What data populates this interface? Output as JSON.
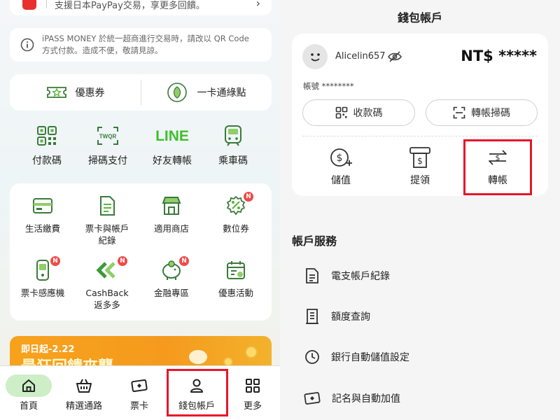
{
  "left": {
    "top_card_text": "支援日本PayPay交易，享更多回饋。",
    "notice_text": "iPASS MONEY 於統一超商進行交易時，請改以 QR Code 方式付款。造成不便，敬請見諒。",
    "coupon_label": "優惠券",
    "points_label": "一卡通綠點",
    "quick_actions": [
      {
        "label": "付款碼",
        "icon": "payment-qr-icon"
      },
      {
        "label": "掃碼支付",
        "icon": "scan-pay-icon",
        "icon_text": "TWQR"
      },
      {
        "label": "好友轉帳",
        "icon": "line-icon",
        "icon_text": "LINE"
      },
      {
        "label": "乘車碼",
        "icon": "train-icon"
      }
    ],
    "services": [
      {
        "label": "生活繳費",
        "icon": "bill-card-icon"
      },
      {
        "label": "票卡與帳戶\n紀錄",
        "icon": "document-icon"
      },
      {
        "label": "適用商店",
        "icon": "store-icon"
      },
      {
        "label": "數位券",
        "icon": "digital-coupon-icon",
        "badge": "N"
      },
      {
        "label": "票卡感應機",
        "icon": "card-reader-icon",
        "badge": "N"
      },
      {
        "label": "CashBack\n返多多",
        "icon": "cashback-icon",
        "badge": "N"
      },
      {
        "label": "金融專區",
        "icon": "piggy-bank-icon",
        "badge": "N"
      },
      {
        "label": "優惠活動",
        "icon": "calendar-promo-icon"
      }
    ],
    "banner_date": "即日起-2.22",
    "banner_title": "最狂回饋來襲",
    "bottom_nav": [
      {
        "label": "首頁",
        "icon": "home-icon",
        "active": true
      },
      {
        "label": "精選通路",
        "icon": "basket-icon"
      },
      {
        "label": "票卡",
        "icon": "card-icon"
      },
      {
        "label": "錢包帳戶",
        "icon": "person-icon",
        "highlighted": true
      },
      {
        "label": "更多",
        "icon": "grid-icon"
      }
    ]
  },
  "right": {
    "page_title": "錢包帳戶",
    "username": "Alicelin657",
    "balance": "NT$ *****",
    "account_label": "帳號 ********",
    "receive_button": "收款碼",
    "transfer_scan_button": "轉帳掃碼",
    "actions": [
      {
        "label": "儲值",
        "icon": "topup-coin-icon"
      },
      {
        "label": "提領",
        "icon": "withdraw-atm-icon"
      },
      {
        "label": "轉帳",
        "icon": "transfer-arrows-icon",
        "highlighted": true
      }
    ],
    "section_title": "帳戶服務",
    "service_rows": [
      {
        "label": "電支帳戶紀錄",
        "icon": "document-list-icon"
      },
      {
        "label": "額度查詢",
        "icon": "receipt-icon"
      },
      {
        "label": "銀行自動儲值設定",
        "icon": "clock-icon"
      },
      {
        "label": "記名與自動加值",
        "icon": "register-card-icon"
      }
    ]
  },
  "colors": {
    "accent_green": "#5ab63c",
    "nav_active_bg": "#cdeec6",
    "highlight_red": "#e8152a",
    "banner_orange": "#f59a1d",
    "badge_red": "#f04a4a"
  }
}
